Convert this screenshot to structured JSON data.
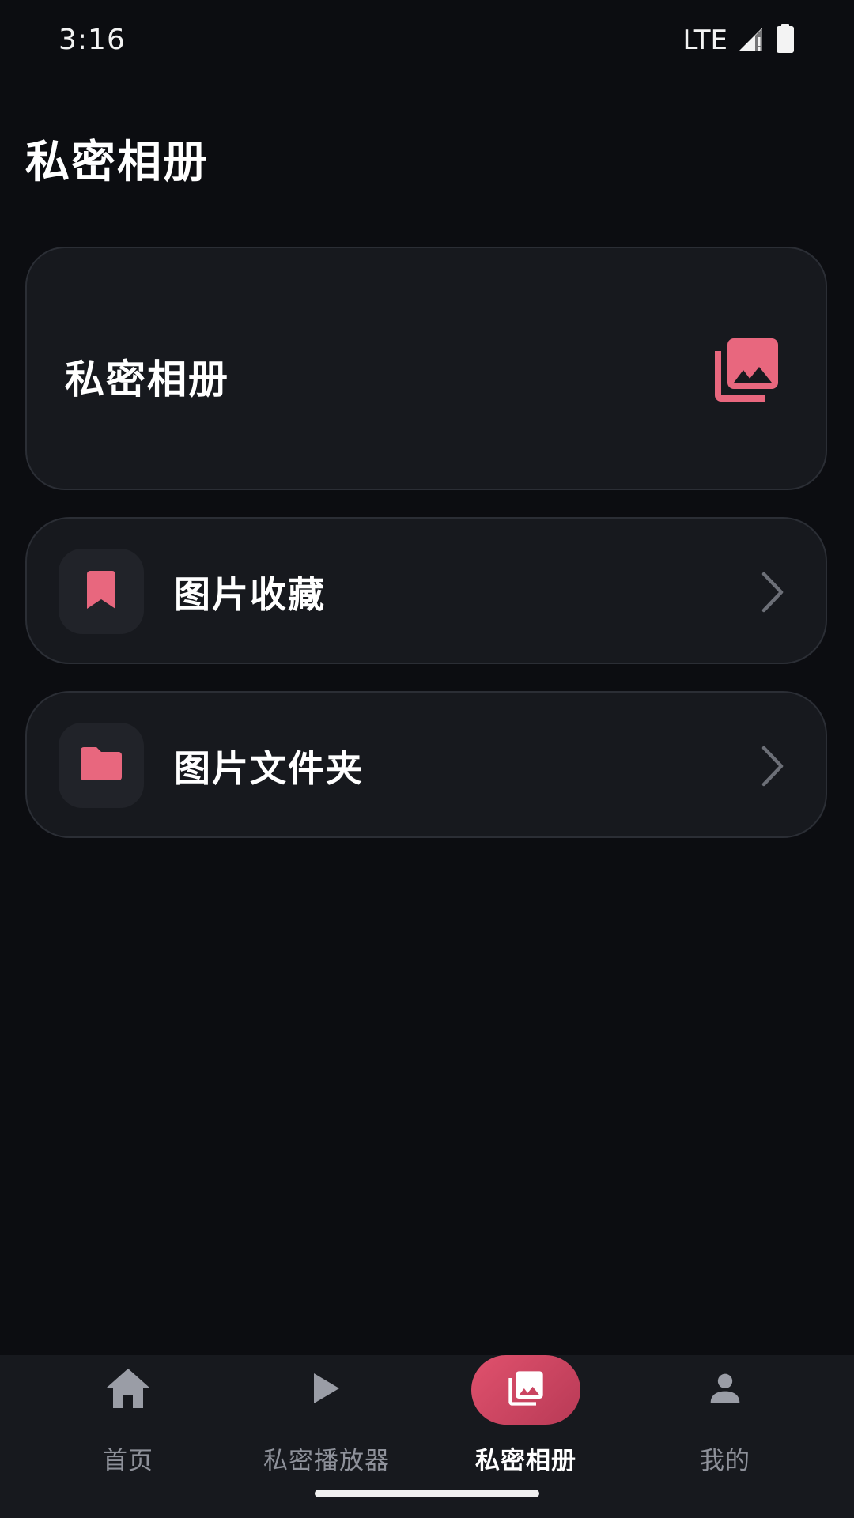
{
  "status_bar": {
    "time": "3:16",
    "network": "LTE",
    "icons": [
      "signal-icon",
      "battery-icon"
    ]
  },
  "page": {
    "title": "私密相册"
  },
  "hero_card": {
    "label": "私密相册",
    "icon": "photo-library-icon"
  },
  "rows": [
    {
      "label": "图片收藏",
      "icon": "bookmark-icon"
    },
    {
      "label": "图片文件夹",
      "icon": "folder-icon"
    }
  ],
  "bottom_nav": {
    "items": [
      {
        "label": "首页",
        "icon": "home-icon",
        "active": false
      },
      {
        "label": "私密播放器",
        "icon": "play-icon",
        "active": false
      },
      {
        "label": "私密相册",
        "icon": "photo-library-icon",
        "active": true
      },
      {
        "label": "我的",
        "icon": "person-icon",
        "active": false
      }
    ]
  },
  "colors": {
    "background": "#0c0d11",
    "card": "#17191e",
    "card_border": "#2b2e35",
    "accent": "#e8677e",
    "nav_active": "#d4465f",
    "nav_inactive": "#8e919a"
  }
}
